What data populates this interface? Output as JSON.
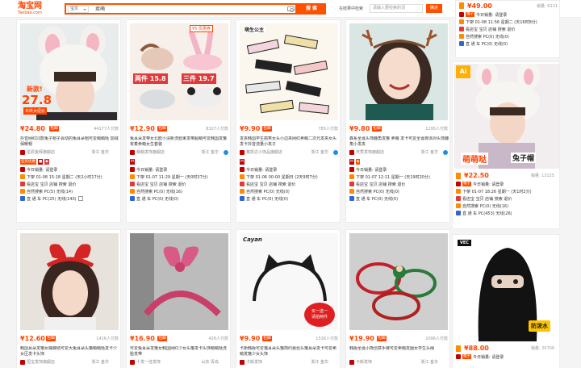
{
  "header": {
    "logo_cn": "淘宝网",
    "logo_en": "Taobao.com",
    "scope": "宝贝",
    "query": "卖萌",
    "search_button": "搜 索",
    "in_result_label": "在结果中检索",
    "in_result_placeholder": "请输入要检索的词",
    "confirm_button": "确定"
  },
  "products": [
    {
      "price": "¥24.80",
      "buyers": "44177人付款",
      "title": "抖音网红同款兔子帽子会动的兔耳朵帽可爱萌萌哒 加绒保暖帽",
      "shop": "星辰金辉旗舰店",
      "location": "浙江 金华",
      "today": "今日销量: 请登录",
      "line2": "下架 01-08 15:18 星期二 (天2小时17分)",
      "line3": "看店宝 宝贝 店铺 搜索 退价",
      "line4": "自然搜索 PC(5) 无线(14)",
      "line5": "直 通 车 PC(25) 无线(140)",
      "promo": "狂欢优惠",
      "overlay1": "新款!",
      "overlay2": "27.8",
      "overlay3": "年终大促价"
    },
    {
      "price": "¥12.90",
      "buyers": "8327人付款",
      "title": "兔耳朵发带女北欧小清新洗脸束发带超萌可爱韩国发箍有着卖萌女生套装",
      "shop": "萌萌发饰旗舰店",
      "location": "浙江 金华",
      "today": "今日销量: 请登录",
      "line2": "下架 01-07 11:29 星期一 (天0时37分)",
      "line3": "看店宝 宝贝 店铺 搜索 退价",
      "line4": "自然搜索 PC(0) 无线(16)",
      "line5": "直 通 车 PC(0) 无线(0)",
      "overlay1": "¥5 优惠券",
      "overlay2": "两件 15.8",
      "overlay3": "三件 19.7"
    },
    {
      "price": "¥9.90",
      "buyers": "785人付款",
      "title": "发夹韩国学生搞笑女头小边夹网红卖萌二次元发夹女头发卡抖音流量小夹子",
      "shop": "格凯达小饰品旗舰店",
      "location": "浙江 金华",
      "today": "今日销量: 请登录",
      "line2": "下架 01-06 00:00 星期日 (2天9时7分)",
      "line3": "看店宝 宝贝 店铺 搜索 退价",
      "line4": "自然搜索 PC(0) 无线(0)",
      "line5": "直 通 车 PC(0) 无线(0)",
      "overlay1": "萌生公主"
    },
    {
      "price": "¥9.80",
      "buyers": "1295人付款",
      "title": "森系圣诞头饰鹿角发箍 卖萌 发卡可爱圣诞夜派对头饰鹿角小发夹",
      "shop": "天秀发饰旗舰店",
      "location": "浙江 金华",
      "today": "今日销量: 请登录",
      "line2": "下架 01-07 12:11 星期一 (天19时20分)",
      "line3": "看店宝 宝贝 店铺 搜索 退价",
      "line4": "自然搜索 PC(0) 无线(0)",
      "line5": "直 通 车 PC(0) 无线(0)"
    },
    {
      "price": "¥49.00",
      "buyers": "销量: 6111",
      "today": "今日销量: 请登录",
      "line2": "下架 01-08 11:56 星期二 (天16时8分)",
      "line3": "看店宝 宝贝 店铺 搜索 退价",
      "line4": "自然搜索 PC(0) 无线(0)",
      "line5": "直 通 车 PC(0) 无线(0)",
      "badge": "福子"
    },
    {
      "price": "¥22.50",
      "buyers": "销量: 13125",
      "today": "今日销量: 请登录",
      "line2": "下架 01-07 18:26 星期一 (天1时2分)",
      "line3": "看店宝 宝贝 店铺 搜索 退价",
      "line4": "自然搜索 PC(0) 无线(16)",
      "line5": "直 通 车 PC(453) 无线(26)",
      "badge": "福子",
      "overlay1": "萌萌哒",
      "overlay2": "兔子帽"
    },
    {
      "price": "¥12.60",
      "buyers": "1416人付款",
      "title": "韩国耳朵发箍女蝴蝶结可爱大兔耳朵头箍萌萌哒发卡少女压发卡头饰",
      "shop": "恒宝发饰旗舰店",
      "location": "浙江 金华"
    },
    {
      "price": "¥16.90",
      "buyers": "426人付款",
      "title": "可爱兔耳朵发箍女韩国网红少女头箍发卡头饰萌萌哒洗脸发带",
      "shop": "十发一佳发饰",
      "location": "山东 青岛"
    },
    {
      "price": "¥9.90",
      "buyers": "1536人付款",
      "title": "卡斯韩版可爱猫耳朵头箍简约蕾丝头箍耳朵发卡可爱卖萌发箍少女头饰",
      "shop": "卡斯发饰",
      "location": "浙江 金华",
      "overlay1": "Cayan",
      "overlay2": "买一送一",
      "overlay3": "请拍两件"
    },
    {
      "price": "¥19.90",
      "buyers": "2096人付款",
      "title": "韩版圣诞小熊创意手链可爱卖萌发圈女学生头绳",
      "shop": "卡斯发饰",
      "location": "浙江 金华"
    },
    {
      "price": "¥88.00",
      "buyers": "销量: 20709",
      "today": "今日销量: 请登录",
      "badge": "福子",
      "overlay1": "VEC",
      "overlay2": "防泼水"
    }
  ]
}
